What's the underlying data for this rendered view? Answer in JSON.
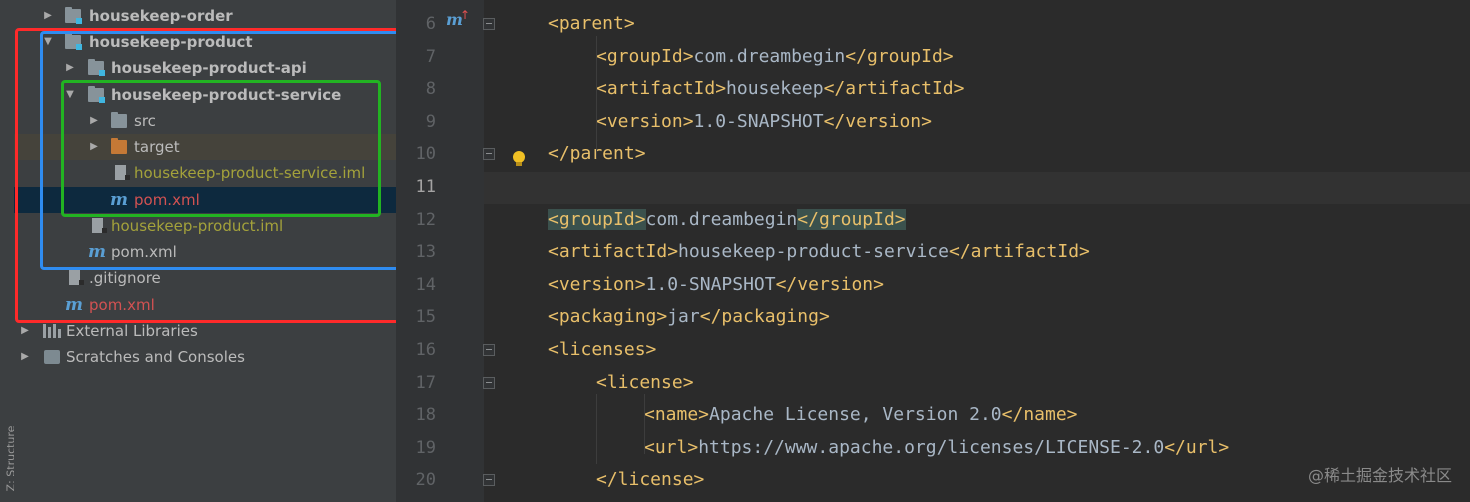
{
  "sidebar": {
    "stripe_label": "Z: Structure"
  },
  "tree": {
    "items": [
      {
        "label": "housekeep-order"
      },
      {
        "label": "housekeep-product"
      },
      {
        "label": "housekeep-product-api"
      },
      {
        "label": "housekeep-product-service"
      },
      {
        "label": "src"
      },
      {
        "label": "target"
      },
      {
        "label": "housekeep-product-service.iml"
      },
      {
        "label": "pom.xml"
      },
      {
        "label": "housekeep-product.iml"
      },
      {
        "label": "pom.xml"
      },
      {
        "label": ".gitignore"
      },
      {
        "label": "pom.xml"
      },
      {
        "label": "External Libraries"
      },
      {
        "label": "Scratches and Consoles"
      }
    ]
  },
  "annotation_colors": {
    "red": "#ff2a2a",
    "blue": "#2f8cf0",
    "green": "#22b322"
  },
  "editor": {
    "line_numbers": [
      "6",
      "7",
      "8",
      "9",
      "10",
      "11",
      "12",
      "13",
      "14",
      "15",
      "16",
      "17",
      "18",
      "19",
      "20"
    ],
    "current_line": "11",
    "lines": [
      {
        "t1": "<parent>"
      },
      {
        "t1": "<groupId>",
        "v": "com.dreambegin",
        "t2": "</groupId>"
      },
      {
        "t1": "<artifactId>",
        "v": "housekeep",
        "t2": "</artifactId>"
      },
      {
        "t1": "<version>",
        "v": "1.0-SNAPSHOT",
        "t2": "</version>"
      },
      {
        "t1": "</parent>"
      },
      {
        "t1": ""
      },
      {
        "t1": "<groupId>",
        "v": "com.dreambegin",
        "t2": "</groupId>"
      },
      {
        "t1": "<artifactId>",
        "v": "housekeep-product-service",
        "t2": "</artifactId>"
      },
      {
        "t1": "<version>",
        "v": "1.0-SNAPSHOT",
        "t2": "</version>"
      },
      {
        "t1": "<packaging>",
        "v": "jar",
        "t2": "</packaging>"
      },
      {
        "t1": "<licenses>"
      },
      {
        "t1": "<license>"
      },
      {
        "t1": "<name>",
        "v": "Apache License, Version 2.0",
        "t2": "</name>"
      },
      {
        "t1": "<url>",
        "v": "https://www.apache.org/licenses/LICENSE-2.0",
        "t2": "</url>"
      },
      {
        "t1": "</license>"
      }
    ]
  },
  "watermark": "@稀土掘金技术社区",
  "icons": {
    "folder": "folder-icon",
    "module": "module-folder-icon",
    "maven": "maven-m-icon",
    "iml": "iml-file-icon",
    "library": "library-icon",
    "bulb": "intention-bulb-icon"
  }
}
